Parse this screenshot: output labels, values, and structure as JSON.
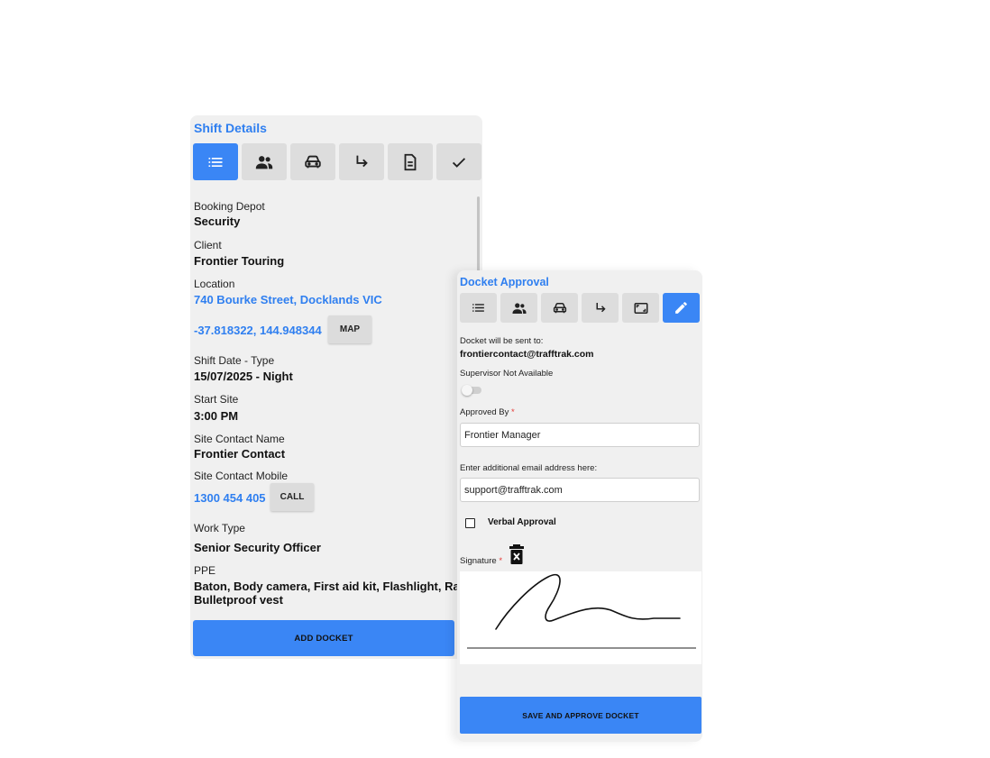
{
  "shift_panel": {
    "title": "Shift Details",
    "tabs": [
      {
        "icon": "list-icon",
        "active": true
      },
      {
        "icon": "people-icon",
        "active": false
      },
      {
        "icon": "car-icon",
        "active": false
      },
      {
        "icon": "turn-arrow-icon",
        "active": false
      },
      {
        "icon": "document-icon",
        "active": false
      },
      {
        "icon": "check-icon",
        "active": false
      }
    ],
    "booking_depot_label": "Booking Depot",
    "booking_depot_value": "Security",
    "client_label": "Client",
    "client_value": "Frontier Touring",
    "location_label": "Location",
    "location_value": "740 Bourke Street, Docklands VIC",
    "coordinates": "-37.818322, 144.948344",
    "map_button": "MAP",
    "shift_date_label": "Shift Date - Type",
    "shift_date_value": "15/07/2025 - Night",
    "start_site_label": "Start Site",
    "start_site_value": "3:00 PM",
    "site_contact_name_label": "Site Contact Name",
    "site_contact_name_value": "Frontier Contact",
    "site_contact_mobile_label": "Site Contact Mobile",
    "site_contact_mobile_value": "1300 454 405",
    "call_button": "CALL",
    "work_type_label": "Work Type",
    "work_type_value": "Senior Security Officer",
    "ppe_label": "PPE",
    "ppe_line1": "Baton, Body camera, First aid kit, Flashlight, Radio",
    "ppe_line2": "Bulletproof vest",
    "add_docket_button": "ADD DOCKET"
  },
  "docket_panel": {
    "title": "Docket Approval",
    "tabs": [
      {
        "icon": "list-icon",
        "active": false
      },
      {
        "icon": "people-icon",
        "active": false
      },
      {
        "icon": "car-icon",
        "active": false
      },
      {
        "icon": "turn-arrow-icon",
        "active": false
      },
      {
        "icon": "fullscreen-icon",
        "active": false
      },
      {
        "icon": "pencil-icon",
        "active": true
      }
    ],
    "sent_to_label": "Docket will be sent to:",
    "sent_to_value": "frontiercontact@trafftrak.com",
    "supervisor_label": "Supervisor Not Available",
    "supervisor_toggle_on": false,
    "approved_by_label": "Approved By",
    "required_mark": "*",
    "approved_by_value": "Frontier Manager",
    "additional_email_label": "Enter additional email address here:",
    "additional_email_value": "support@trafftrak.com",
    "verbal_approval_label": "Verbal Approval",
    "verbal_approval_checked": false,
    "signature_label": "Signature",
    "save_button": "SAVE AND APPROVE DOCKET"
  },
  "colors": {
    "accent": "#3a86f5",
    "link": "#2f7ff0",
    "panel_bg": "#f0f0f0",
    "required": "#e53935"
  }
}
